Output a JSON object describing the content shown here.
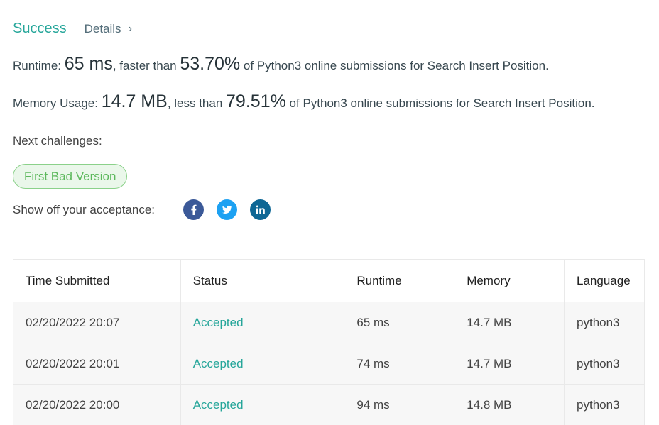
{
  "header": {
    "status": "Success",
    "details_label": "Details",
    "details_chevron": "›"
  },
  "runtime": {
    "label": "Runtime: ",
    "value": "65 ms",
    "middle": ", faster than ",
    "percent": "53.70%",
    "suffix": " of Python3 online submissions for Search Insert Position."
  },
  "memory": {
    "label": "Memory Usage: ",
    "value": "14.7 MB",
    "middle": ", less than ",
    "percent": "79.51%",
    "suffix": " of Python3 online submissions for Search Insert Position."
  },
  "next": {
    "label": "Next challenges:",
    "challenges": [
      "First Bad Version"
    ]
  },
  "share": {
    "label": "Show off your acceptance:",
    "icons": [
      "facebook-icon",
      "twitter-icon",
      "linkedin-icon"
    ]
  },
  "table": {
    "headers": [
      "Time Submitted",
      "Status",
      "Runtime",
      "Memory",
      "Language"
    ],
    "rows": [
      [
        "02/20/2022 20:07",
        "Accepted",
        "65 ms",
        "14.7 MB",
        "python3"
      ],
      [
        "02/20/2022 20:01",
        "Accepted",
        "74 ms",
        "14.7 MB",
        "python3"
      ],
      [
        "02/20/2022 20:00",
        "Accepted",
        "94 ms",
        "14.8 MB",
        "python3"
      ]
    ]
  },
  "colors": {
    "success": "#26a69a",
    "challenge_text": "#5cb85c",
    "facebook": "#3b5998",
    "twitter": "#1da1f2",
    "linkedin": "#0e6795"
  }
}
